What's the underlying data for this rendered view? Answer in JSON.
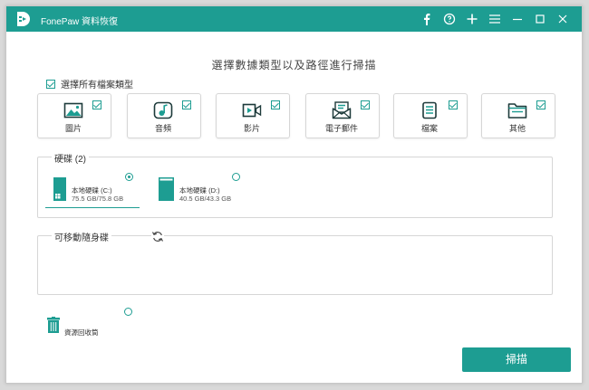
{
  "app": {
    "title": "FonePaw 資料恢復"
  },
  "titlebar_icons": [
    "facebook-icon",
    "feedback-icon",
    "plus-icon",
    "menu-icon",
    "minimize-icon",
    "maximize-icon",
    "close-icon"
  ],
  "heading": "選擇數據類型以及路徑進行掃描",
  "select_all": {
    "label": "選擇所有檔案類型",
    "checked": true
  },
  "file_types": [
    {
      "label": "圖片",
      "icon": "image-icon",
      "checked": true
    },
    {
      "label": "音頻",
      "icon": "music-icon",
      "checked": true
    },
    {
      "label": "影片",
      "icon": "video-icon",
      "checked": true
    },
    {
      "label": "電子郵件",
      "icon": "email-icon",
      "checked": true
    },
    {
      "label": "檔案",
      "icon": "document-icon",
      "checked": true
    },
    {
      "label": "其他",
      "icon": "folder-icon",
      "checked": true
    }
  ],
  "hard_drives": {
    "title": "硬碟 (2)",
    "drives": [
      {
        "name": "本地硬碟 (C:)",
        "size": "75.5 GB/75.8 GB",
        "selected": true
      },
      {
        "name": "本地硬碟 (D:)",
        "size": "40.5 GB/43.3 GB",
        "selected": false
      }
    ]
  },
  "removable": {
    "title": "可移動隨身碟",
    "refresh_icon": "refresh-icon"
  },
  "recycle_bin": {
    "label": "資源回收筒",
    "selected": false
  },
  "scan_button": "掃描",
  "colors": {
    "accent": "#1d9d92"
  }
}
